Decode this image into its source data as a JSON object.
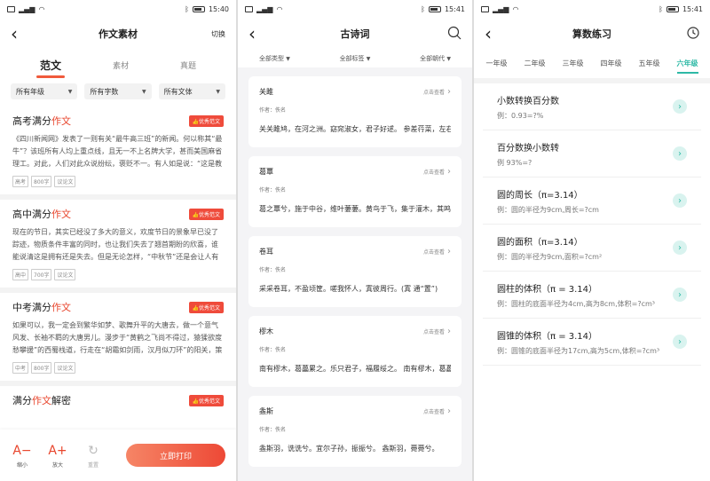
{
  "status": {
    "screen1_time": "15:40",
    "screen2_time": "15:41",
    "screen3_time": "15:41"
  },
  "screen1": {
    "title": "作文素材",
    "right_action": "切换",
    "tabs": [
      {
        "label": "范文",
        "active": true
      },
      {
        "label": "素材",
        "active": false
      },
      {
        "label": "真题",
        "active": false
      }
    ],
    "filters": [
      "所有年级",
      "所有字数",
      "所有文体"
    ],
    "badge_label": "优秀范文",
    "essays": [
      {
        "prefix": "高考满分",
        "highlight": "作文",
        "suffix": "",
        "text": "《四川新闻网》发表了一则有关“最牛高三班”的新闻。何以称其“最牛”？该班所有人均上重点线，且无一不上名牌大学，甚而美国麻省理工。对此，人们对此众说纷纭，褒贬不一。有人如是说：“这是教育的不公平！凭什么他们就享受优于他人的教育……",
        "tags": [
          "高考",
          "800字",
          "议论文"
        ]
      },
      {
        "prefix": "高中满分",
        "highlight": "作文",
        "suffix": "",
        "text": "现在的节日，其实已经没了多大的意义，欢度节日的景象早已没了踪迹，物质条件丰富的同时，也让我们失去了翘首期盼的欣喜，谁能说清这是拥有还是失去。但是无论怎样，“中秋节”还是会让人有些特别不一样的感触，人们已渐渐习惯在这个节日……",
        "tags": [
          "高中",
          "700字",
          "议论文"
        ]
      },
      {
        "prefix": "中考满分",
        "highlight": "作文",
        "suffix": "",
        "text": "如果可以，我一定会到繁华如梦、歌舞升平的大唐去，做一个意气风发、长袖不羁的大唐男儿。漫步于“黄鹤之飞尚不得过，猿猱欲度愁攀援”的西蜀栈道，行走在“胡霜如剑雨，汉月似刀环”的阳关，策马飞奔于广袤的大漠，领略“大漠孤烟直”的美丽与……",
        "tags": [
          "中考",
          "800字",
          "议论文"
        ]
      },
      {
        "prefix": "满分",
        "highlight": "作文",
        "suffix": "解密",
        "text": "",
        "tags": []
      }
    ],
    "toolbar": {
      "shrink_glyph": "A−",
      "shrink_label": "缩小",
      "enlarge_glyph": "A+",
      "enlarge_label": "放大",
      "reset_glyph": "↻",
      "reset_label": "重置",
      "print_label": "立即打印"
    }
  },
  "screen2": {
    "title": "古诗词",
    "filters": [
      "全部类型",
      "全部标签",
      "全部朝代"
    ],
    "view_label": "点击查看",
    "author_label": "作者：佚名",
    "poems": [
      {
        "title": "关雎",
        "text": "关关雎鸠，在河之洲。窈窕淑女，君子好逑。 参差荇菜，左右流之。"
      },
      {
        "title": "葛覃",
        "text": "葛之覃兮，施于中谷，维叶萋萋。黄鸟于飞，集于灌木，其鸣喈喈。"
      },
      {
        "title": "卷耳",
        "text": "采采卷耳，不盈顷筐。嗟我怀人，寘彼周行。(寘 通“置”)"
      },
      {
        "title": "樛木",
        "text": "南有樛木，葛藟累之。乐只君子，福履绥之。 南有樛木，葛藟荒之。"
      },
      {
        "title": "螽斯",
        "text": "螽斯羽，诜诜兮。宜尔子孙，振振兮。 螽斯羽，薨薨兮。"
      }
    ]
  },
  "screen3": {
    "title": "算数练习",
    "grades": [
      {
        "label": "一年级",
        "active": false
      },
      {
        "label": "二年级",
        "active": false
      },
      {
        "label": "三年级",
        "active": false
      },
      {
        "label": "四年级",
        "active": false
      },
      {
        "label": "五年级",
        "active": false
      },
      {
        "label": "六年级",
        "active": true
      }
    ],
    "topics": [
      {
        "title": "小数转换百分数",
        "example": "例：0.93=?%"
      },
      {
        "title": "百分数换小数转",
        "example": "例 93%=?"
      },
      {
        "title": "圆的周长（π=3.14）",
        "example": "例：圆的半径为9cm,周长=?cm"
      },
      {
        "title": "圆的面积（π=3.14）",
        "example": "例：圆的半径为9cm,面积=?cm²"
      },
      {
        "title": "圆柱的体积（π = 3.14）",
        "example": "例：圆柱的底面半径为4cm,高为8cm,体积=?cm³"
      },
      {
        "title": "圆锥的体积（π = 3.14）",
        "example": "例：圆锥的底面半径为17cm,高为5cm,体积=?cm³"
      }
    ]
  }
}
